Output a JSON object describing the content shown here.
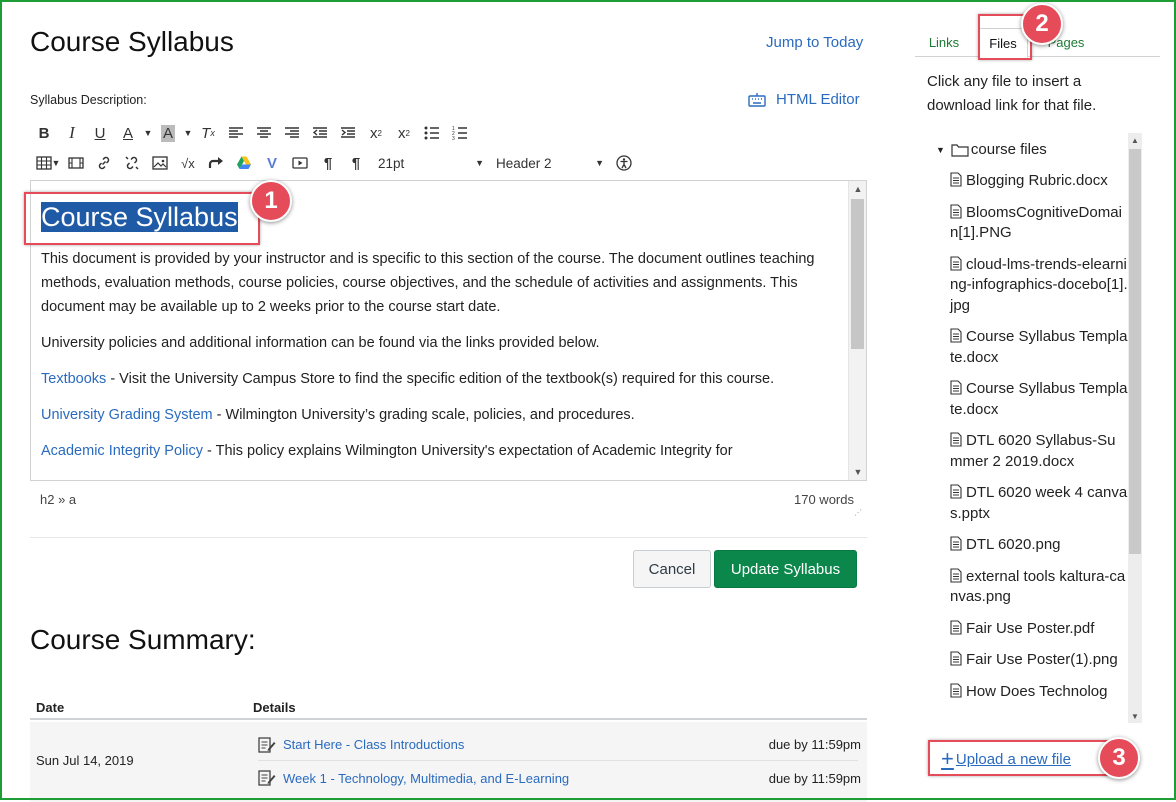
{
  "page": {
    "title": "Course Syllabus",
    "jump_link": "Jump to Today",
    "description_label": "Syllabus Description:",
    "html_editor_label": "HTML Editor"
  },
  "toolbar": {
    "font_size": "21pt",
    "block_format": "Header 2"
  },
  "editor": {
    "heading": "Course Syllabus",
    "para1": "This document is provided by your instructor and is specific to this section of the course. The document outlines teaching methods, evaluation methods, course policies, course objectives, and the schedule of activities and assignments. This document may be available up to 2 weeks prior to the course start date.",
    "para2": "University policies and additional information can be found via the links provided below.",
    "link1": "Textbooks",
    "link1_text": " - Visit the University Campus Store to find the specific edition of the textbook(s) required for this course.",
    "link2": "University Grading System",
    "link2_text": " - Wilmington University’s grading scale, policies, and procedures.",
    "link3": "Academic Integrity Policy",
    "link3_text": " - This policy explains Wilmington University's expectation of Academic Integrity for",
    "status_path": "h2 » a",
    "word_count": "170 words"
  },
  "buttons": {
    "cancel": "Cancel",
    "update": "Update Syllabus"
  },
  "summary": {
    "title": "Course Summary:",
    "col_date": "Date",
    "col_details": "Details",
    "date": "Sun Jul 14, 2019",
    "events": [
      {
        "title": "Start Here - Class Introductions",
        "due": "due by 11:59pm"
      },
      {
        "title": "Week 1 - Technology, Multimedia, and E-Learning",
        "due": "due by 11:59pm"
      }
    ]
  },
  "sidebar": {
    "tabs": [
      "Links",
      "Files",
      "Pages"
    ],
    "help": "Click any file to insert a download link for that file.",
    "folder": "course files",
    "files": [
      "Blogging Rubric.docx",
      "BloomsCognitiveDomain[1].PNG",
      "cloud-lms-trends-elearning-infographics-docebo[1].jpg",
      "Course Syllabus Template.docx",
      "Course Syllabus Template.docx",
      "DTL 6020 Syllabus-Summer 2 2019.docx",
      "DTL 6020 week 4 canvas.pptx",
      "DTL 6020.png",
      "external tools kaltura-canvas.png",
      "Fair Use Poster.pdf",
      "Fair Use Poster(1).png",
      "How Does Technolog"
    ],
    "upload": "Upload a new file"
  },
  "callouts": [
    "1",
    "2",
    "3"
  ],
  "colors": {
    "accent_green": "#0b874b",
    "link_blue": "#2a6bbf",
    "callout_red": "#e64b5a",
    "selection": "#1f5aa6"
  }
}
